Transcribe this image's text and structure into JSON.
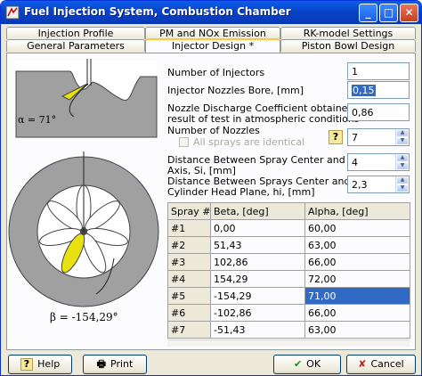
{
  "window": {
    "title": "Fuel Injection System, Combustion Chamber",
    "controls": {
      "minimize": "_",
      "maximize": "□",
      "close": "✕"
    }
  },
  "tabs": {
    "row1": [
      "Injection Profile",
      "PM and NOx Emission",
      "RK-model Settings"
    ],
    "row2": [
      "General Parameters",
      "Injector Design *",
      "Piston Bowl Design"
    ],
    "active": "Injector Design *"
  },
  "figures": {
    "alpha_label": "α = 71°",
    "beta_label": "β = -154,29°"
  },
  "form": {
    "num_injectors": {
      "label": "Number of Injectors",
      "value": "1"
    },
    "nozzle_bore": {
      "label": "Injector Nozzles Bore, [mm]",
      "value": "0,15"
    },
    "discharge_coef": {
      "label_line1": "Nozzle Discharge Coefficient obtained as a",
      "label_line2": "result of test in atmospheric conditions",
      "value": "0,86"
    },
    "num_nozzles": {
      "label": "Number of Nozzles",
      "value": "7",
      "help": "?"
    },
    "identical": {
      "label": "All sprays are identical",
      "checked": false
    },
    "dist_bowl_axis": {
      "label_line1": "Distance Between Spray Center and Bowl",
      "label_line2": "Axis, Si, [mm]",
      "value": "4"
    },
    "dist_head_plane": {
      "label_line1": "Distance Between Sprays Center and",
      "label_line2": "Cylinder Head Plane, hi, [mm]",
      "value": "2,3"
    }
  },
  "table": {
    "headers": [
      "Spray #",
      "Beta, [deg]",
      "Alpha, [deg]"
    ],
    "rows": [
      [
        "#1",
        "0,00",
        "60,00"
      ],
      [
        "#2",
        "51,43",
        "63,00"
      ],
      [
        "#3",
        "102,86",
        "66,00"
      ],
      [
        "#4",
        "154,29",
        "72,00"
      ],
      [
        "#5",
        "-154,29",
        "71,00"
      ],
      [
        "#6",
        "-102,86",
        "66,00"
      ],
      [
        "#7",
        "-51,43",
        "63,00"
      ]
    ],
    "selected_row": 4
  },
  "buttons": {
    "help": "Help",
    "print": "Print",
    "ok": "OK",
    "cancel": "Cancel"
  },
  "colors": {
    "title_bar": "#0844c7",
    "selection": "#316ac5",
    "spray": "#e8e010",
    "piston_gray": "#a0a0a0"
  }
}
